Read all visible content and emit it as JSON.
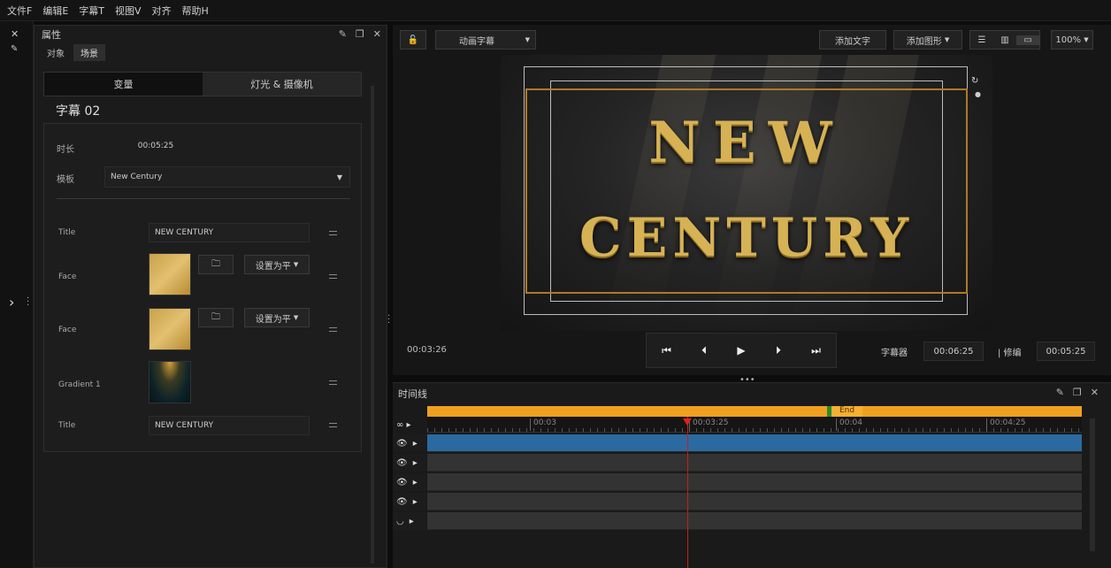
{
  "menu": [
    "文件F",
    "编辑E",
    "字幕T",
    "视图V",
    "对齐",
    "帮助H"
  ],
  "properties": {
    "title": "属性",
    "subtabs": [
      "对象",
      "场景"
    ],
    "segments": [
      "变量",
      "灯光 & 摄像机"
    ],
    "caption_title": "字幕 02",
    "duration_label": "时长",
    "duration_value": "00:05:25",
    "template_label": "模板",
    "template_value": "New Century",
    "rows": [
      {
        "label": "Title",
        "value": "NEW CENTURY"
      },
      {
        "label": "Face",
        "button": "设置为平"
      },
      {
        "label": "Face",
        "button": "设置为平"
      },
      {
        "label": "Gradient 1"
      },
      {
        "label": "Title",
        "value": "NEW CENTURY"
      }
    ]
  },
  "preview": {
    "mode": "动画字幕",
    "add_text": "添加文字",
    "add_shape": "添加图形",
    "zoom": "100%",
    "title_line1": "NEW",
    "title_line2": "CENTURY",
    "current_time": "00:03:26",
    "caption_label": "字幕器",
    "caption_time": "00:06:25",
    "trim_label": "| 修编",
    "trim_time": "00:05:25"
  },
  "timeline": {
    "title": "时间线",
    "end_marker": "End",
    "ticks": [
      "00:03",
      "00:03:25",
      "00:04",
      "00:04:25"
    ]
  }
}
